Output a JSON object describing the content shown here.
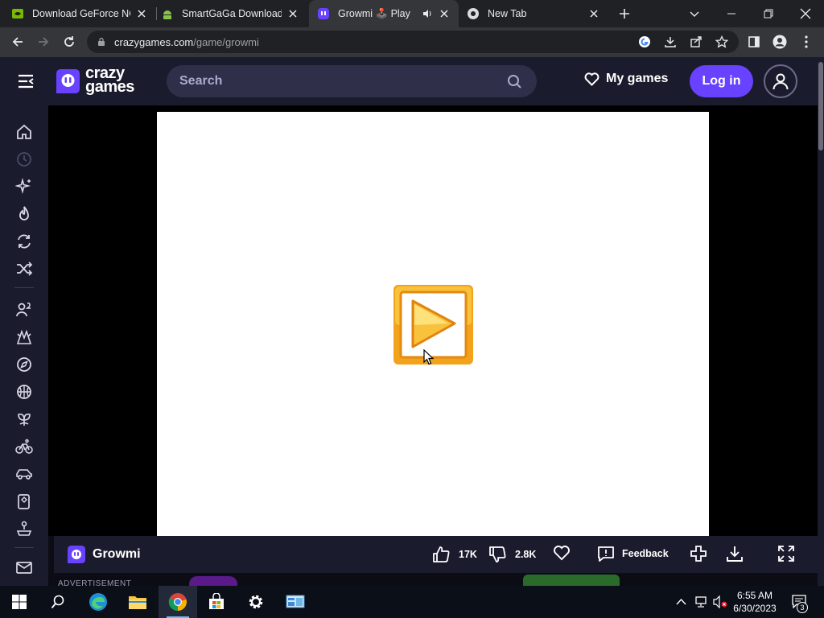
{
  "browser": {
    "tabs": [
      {
        "title": "Download GeForce NOW"
      },
      {
        "title": "SmartGaGa Download"
      },
      {
        "title": "Growmi 🕹️ Play on"
      },
      {
        "title": "New Tab"
      }
    ],
    "url_domain": "crazygames.com",
    "url_path": "/game/growmi"
  },
  "site": {
    "logo_line1": "crazy",
    "logo_line2": "games",
    "search_placeholder": "Search",
    "my_games_label": "My games",
    "login_label": "Log in",
    "accent_color": "#6842ff"
  },
  "sidebar": {
    "items": [
      "home-icon",
      "recent-icon",
      "new-icon",
      "trending-icon",
      "updated-icon",
      "random-icon",
      "multiplayer-icon",
      "action-icon",
      "adventure-icon",
      "basketball-icon",
      "casual-icon",
      "bike-icon",
      "car-icon",
      "card-icon",
      "controller-icon",
      "mail-icon"
    ]
  },
  "game": {
    "name": "Growmi",
    "likes": "17K",
    "dislikes": "2.8K",
    "feedback_label": "Feedback",
    "ad_label": "ADVERTISEMENT"
  },
  "taskbar": {
    "time": "6:55 AM",
    "date": "6/30/2023",
    "notifications": "3"
  }
}
